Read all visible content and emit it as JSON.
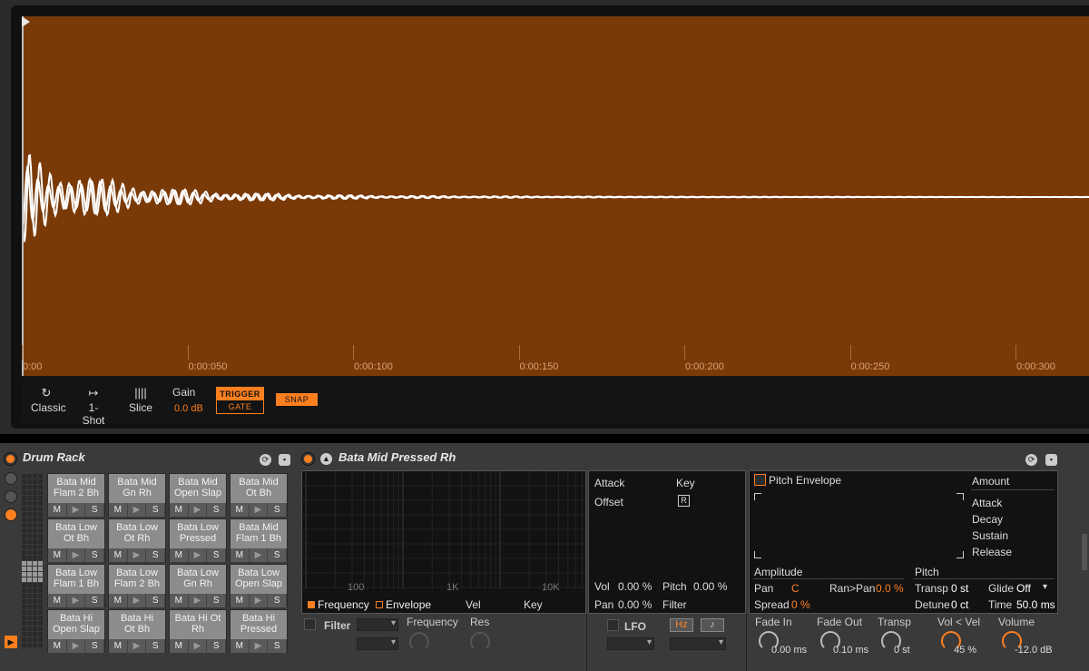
{
  "clip": {
    "ruler": [
      "0:00",
      "0:00:050",
      "0:00:100",
      "0:00:150",
      "0:00:200",
      "0:00:250",
      "0:00:300"
    ],
    "modes": [
      {
        "label": "Classic",
        "icon": "loop-icon"
      },
      {
        "label": "1-Shot",
        "icon": "one-shot-icon"
      },
      {
        "label": "Slice",
        "icon": "slice-icon"
      }
    ],
    "gain_label": "Gain",
    "gain_value": "0.0 dB",
    "trigger_label": "TRIGGER",
    "gate_label": "GATE",
    "snap_label": "SNAP",
    "waveform_color": "#7a3a08",
    "accent_color": "#ff7f1f"
  },
  "drum_rack": {
    "title": "Drum Rack",
    "pad_controls": {
      "mute": "M",
      "play": "▶",
      "solo": "S"
    },
    "pads": [
      {
        "line1": "Bata Mid",
        "line2": "Flam 2 Bh"
      },
      {
        "line1": "Bata Mid",
        "line2": "Gn Rh"
      },
      {
        "line1": "Bata Mid",
        "line2": "Open Slap"
      },
      {
        "line1": "Bata Mid",
        "line2": "Ot Bh"
      },
      {
        "line1": "Bata Low",
        "line2": "Ot Bh"
      },
      {
        "line1": "Bata Low",
        "line2": "Ot Rh"
      },
      {
        "line1": "Bata Low",
        "line2": "Pressed"
      },
      {
        "line1": "Bata Mid",
        "line2": "Flam 1 Bh"
      },
      {
        "line1": "Bata Low",
        "line2": "Flam 1 Bh"
      },
      {
        "line1": "Bata Low",
        "line2": "Flam 2 Bh"
      },
      {
        "line1": "Bata Low",
        "line2": "Gn Rh"
      },
      {
        "line1": "Bata Low",
        "line2": "Open Slap"
      },
      {
        "line1": "Bata Hi",
        "line2": "Open Slap"
      },
      {
        "line1": "Bata Hi",
        "line2": "Ot Bh"
      },
      {
        "line1": "Bata Hi Ot",
        "line2": "Rh"
      },
      {
        "line1": "Bata Hi",
        "line2": "Pressed"
      }
    ]
  },
  "sampler": {
    "title": "Bata Mid Pressed Rh",
    "graph_ticks": [
      "100",
      "1K",
      "10K"
    ],
    "graph_tabs": [
      "Frequency",
      "Envelope",
      "Vel",
      "Key"
    ],
    "mod": {
      "attack": "Attack",
      "key": "Key",
      "offset": "Offset",
      "key_btn": "R",
      "vol": "Vol",
      "vol_val": "0.00 %",
      "pitch": "Pitch",
      "pitch_val": "0.00 %",
      "pan": "Pan",
      "pan_val": "0.00 %",
      "filter": "Filter"
    },
    "env": {
      "pitch_envelope": "Pitch Envelope",
      "amount": "Amount",
      "stages": [
        "Attack",
        "Decay",
        "Sustain",
        "Release"
      ],
      "amplitude": "Amplitude",
      "pitch": "Pitch",
      "pan": "Pan",
      "pan_val": "C",
      "ran_pan": "Ran>Pan",
      "ran_pan_val": "0.0 %",
      "spread": "Spread",
      "spread_val": "0 %",
      "transp": "Transp",
      "transp_val": "0 st",
      "glide": "Glide",
      "glide_val": "Off",
      "detune": "Detune",
      "detune_val": "0 ct",
      "time": "Time",
      "time_val": "50.0 ms"
    },
    "filter_label": "Filter",
    "frequency_label": "Frequency",
    "res_label": "Res",
    "lfo_label": "LFO",
    "hz_label": "Hz",
    "note_label": "♪",
    "knobs": [
      {
        "label": "Fade In",
        "value": "0.00 ms"
      },
      {
        "label": "Fade Out",
        "value": "0.10 ms"
      },
      {
        "label": "Transp",
        "value": "0 st"
      },
      {
        "label": "Vol < Vel",
        "value": "45 %"
      },
      {
        "label": "Volume",
        "value": "-12.0 dB"
      }
    ]
  }
}
